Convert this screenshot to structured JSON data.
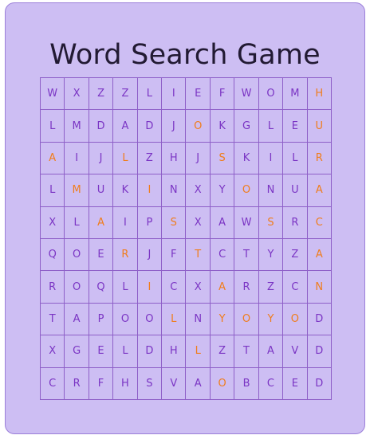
{
  "title": "Word Search Game",
  "colors": {
    "background": "#cdbef3",
    "border": "#9b7fd9",
    "grid_line": "#8e5fc8",
    "letter": "#7b35c4",
    "highlight": "#f07d1c",
    "title": "#221a33"
  },
  "grid": {
    "rows": [
      [
        "W",
        "X",
        "Z",
        "Z",
        "L",
        "I",
        "E",
        "F",
        "W",
        "O",
        "M",
        "H"
      ],
      [
        "L",
        "M",
        "D",
        "A",
        "D",
        "J",
        "O",
        "K",
        "G",
        "L",
        "E",
        "U"
      ],
      [
        "A",
        "I",
        "J",
        "L",
        "Z",
        "H",
        "J",
        "S",
        "K",
        "I",
        "L",
        "R"
      ],
      [
        "L",
        "M",
        "U",
        "K",
        "I",
        "N",
        "X",
        "Y",
        "O",
        "N",
        "U",
        "A"
      ],
      [
        "X",
        "L",
        "A",
        "I",
        "P",
        "S",
        "X",
        "A",
        "W",
        "S",
        "R",
        "C"
      ],
      [
        "Q",
        "O",
        "E",
        "R",
        "J",
        "F",
        "T",
        "C",
        "T",
        "Y",
        "Z",
        "A"
      ],
      [
        "R",
        "O",
        "Q",
        "L",
        "I",
        "C",
        "X",
        "A",
        "R",
        "Z",
        "C",
        "N"
      ],
      [
        "T",
        "A",
        "P",
        "O",
        "O",
        "L",
        "N",
        "Y",
        "O",
        "Y",
        "O",
        "D"
      ],
      [
        "X",
        "G",
        "E",
        "L",
        "D",
        "H",
        "L",
        "Z",
        "T",
        "A",
        "V",
        "D"
      ],
      [
        "C",
        "R",
        "F",
        "H",
        "S",
        "V",
        "A",
        "O",
        "B",
        "C",
        "E",
        "D"
      ]
    ],
    "highlighted": [
      [
        0,
        11
      ],
      [
        1,
        11
      ],
      [
        2,
        11
      ],
      [
        3,
        11
      ],
      [
        4,
        11
      ],
      [
        5,
        11
      ],
      [
        6,
        11
      ],
      [
        1,
        6
      ],
      [
        2,
        7
      ],
      [
        3,
        8
      ],
      [
        4,
        9
      ],
      [
        2,
        0
      ],
      [
        3,
        1
      ],
      [
        4,
        2
      ],
      [
        5,
        3
      ],
      [
        6,
        4
      ],
      [
        7,
        5
      ],
      [
        8,
        6
      ],
      [
        9,
        7
      ],
      [
        2,
        3
      ],
      [
        3,
        4
      ],
      [
        4,
        5
      ],
      [
        5,
        6
      ],
      [
        6,
        7
      ],
      [
        7,
        8
      ],
      [
        7,
        7
      ],
      [
        7,
        9
      ],
      [
        7,
        10
      ]
    ]
  }
}
